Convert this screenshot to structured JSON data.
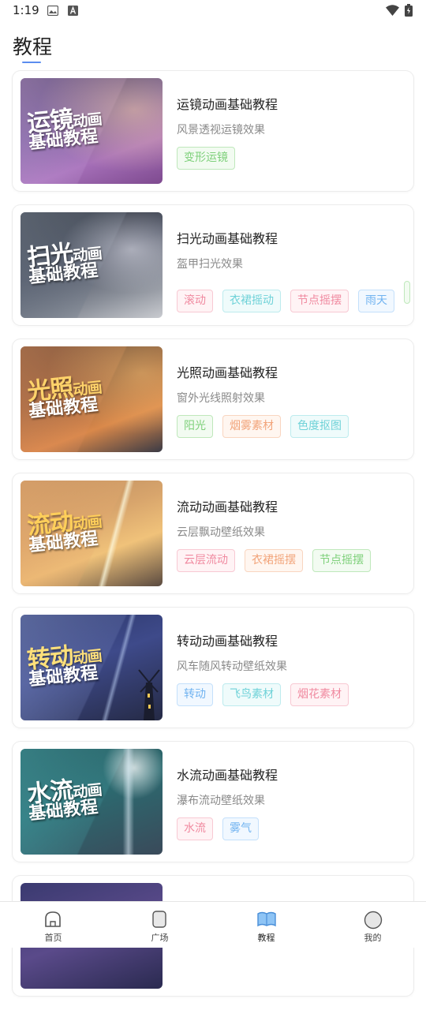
{
  "status_bar": {
    "time": "1:19"
  },
  "page": {
    "title": "教程"
  },
  "cards": [
    {
      "title": "运镜动画基础教程",
      "subtitle": "风景透视运镜效果",
      "thumb_big": "运镜",
      "thumb_mid": "动画",
      "thumb_line2": "基础教程",
      "tags": [
        {
          "label": "变形运镜",
          "color": "green"
        }
      ]
    },
    {
      "title": "扫光动画基础教程",
      "subtitle": "盔甲扫光效果",
      "thumb_big": "扫光",
      "thumb_mid": "动画",
      "thumb_line2": "基础教程",
      "tags": [
        {
          "label": "滚动",
          "color": "pink"
        },
        {
          "label": "衣裙摇动",
          "color": "cyan"
        },
        {
          "label": "节点摇摆",
          "color": "pink"
        },
        {
          "label": "雨天",
          "color": "blue"
        }
      ]
    },
    {
      "title": "光照动画基础教程",
      "subtitle": "窗外光线照射效果",
      "thumb_big": "光照",
      "thumb_mid": "动画",
      "thumb_line2": "基础教程",
      "tags": [
        {
          "label": "阳光",
          "color": "green"
        },
        {
          "label": "烟雾素材",
          "color": "orange"
        },
        {
          "label": "色度抠图",
          "color": "cyan"
        }
      ]
    },
    {
      "title": "流动动画基础教程",
      "subtitle": "云层飘动壁纸效果",
      "thumb_big": "流动",
      "thumb_mid": "动画",
      "thumb_line2": "基础教程",
      "tags": [
        {
          "label": "云层流动",
          "color": "pink"
        },
        {
          "label": "衣裙摇摆",
          "color": "orange"
        },
        {
          "label": "节点摇摆",
          "color": "green"
        }
      ]
    },
    {
      "title": "转动动画基础教程",
      "subtitle": "风车随风转动壁纸效果",
      "thumb_big": "转动",
      "thumb_mid": "动画",
      "thumb_line2": "基础教程",
      "tags": [
        {
          "label": "转动",
          "color": "blue"
        },
        {
          "label": "飞鸟素材",
          "color": "cyan"
        },
        {
          "label": "烟花素材",
          "color": "pink"
        }
      ]
    },
    {
      "title": "水流动画基础教程",
      "subtitle": "瀑布流动壁纸效果",
      "thumb_big": "水流",
      "thumb_mid": "动画",
      "thumb_line2": "基础教程",
      "tags": [
        {
          "label": "水流",
          "color": "pink"
        },
        {
          "label": "雾气",
          "color": "blue"
        }
      ]
    },
    {
      "title": "",
      "subtitle": "",
      "thumb_big": "",
      "thumb_mid": "",
      "thumb_line2": "",
      "tags": []
    }
  ],
  "nav": {
    "items": [
      {
        "label": "首页",
        "icon": "home-icon"
      },
      {
        "label": "广场",
        "icon": "square-icon"
      },
      {
        "label": "教程",
        "icon": "book-icon"
      },
      {
        "label": "我的",
        "icon": "profile-icon"
      }
    ],
    "active_color": "#5b8def"
  }
}
